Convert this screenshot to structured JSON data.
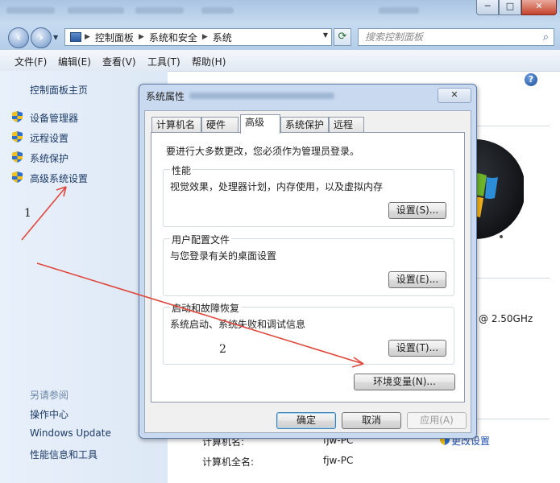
{
  "window": {
    "title_blurred": true,
    "buttons": {
      "minimize": "─",
      "maximize": "□",
      "close": "✕"
    }
  },
  "address_bar": {
    "breadcrumbs": [
      "控制面板",
      "系统和安全",
      "系统"
    ],
    "search_placeholder": "搜索控制面板"
  },
  "menu": [
    "文件(F)",
    "编辑(E)",
    "查看(V)",
    "工具(T)",
    "帮助(H)"
  ],
  "left_pane": {
    "home": "控制面板主页",
    "links": [
      "设备管理器",
      "远程设置",
      "系统保护",
      "高级系统设置"
    ],
    "see_also_header": "另请参阅",
    "see_also": [
      "操作中心",
      "Windows Update",
      "性能信息和工具"
    ]
  },
  "right_pane": {
    "cpu_speed": "@ 2.50GHz",
    "computer_name_label": "计算机名:",
    "computer_name": "fjw-PC",
    "full_name_label": "计算机全名:",
    "full_name": "fjw-PC",
    "change_settings": "更改设置"
  },
  "annotations": {
    "step1": "1",
    "step2": "2"
  },
  "dialog": {
    "title": "系统属性",
    "close": "✕",
    "tabs": [
      "计算机名",
      "硬件",
      "高级",
      "系统保护",
      "远程"
    ],
    "active_tab": "高级",
    "notice": "要进行大多数更改，您必须作为管理员登录。",
    "groups": [
      {
        "title": "性能",
        "desc": "视觉效果，处理器计划，内存使用，以及虚拟内存",
        "button": "设置(S)..."
      },
      {
        "title": "用户配置文件",
        "desc": "与您登录有关的桌面设置",
        "button": "设置(E)..."
      },
      {
        "title": "启动和故障恢复",
        "desc": "系统启动、系统失败和调试信息",
        "button": "设置(T)..."
      }
    ],
    "env_button": "环境变量(N)...",
    "ok": "确定",
    "cancel": "取消",
    "apply": "应用(A)"
  },
  "colors": {
    "arrow": "#e0473c",
    "link": "#1e3b68"
  }
}
